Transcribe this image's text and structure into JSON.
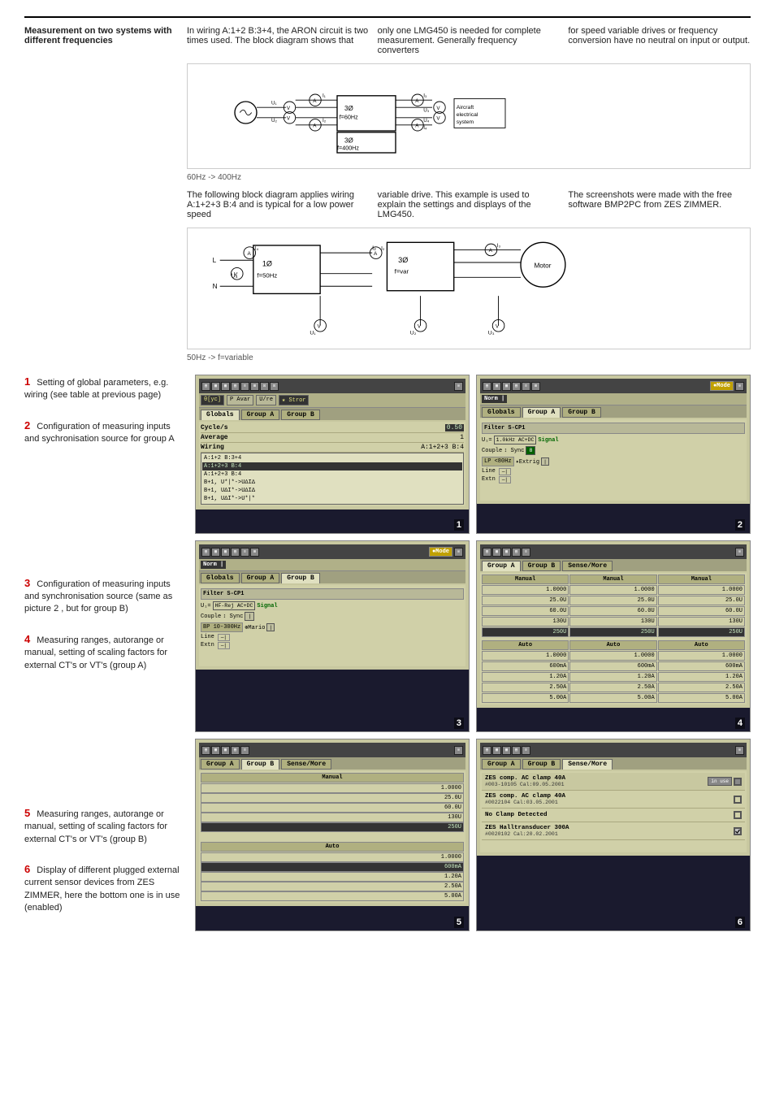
{
  "page": {
    "top": {
      "label": "Measurement on two systems with different frequencies",
      "col1": "In wiring A:1+2 B:3+4, the ARON circuit is two times used. The block diagram shows that",
      "col2": "only one LMG450 is needed for complete measurement. Generally frequency converters",
      "col3": "for speed variable drives or frequency conversion have no neutral on input or output."
    },
    "caption1": "60Hz -> 400Hz",
    "middle": {
      "col1": "The following block diagram applies wiring A:1+2+3 B:4 and is typical for a low power speed",
      "col2": "variable drive. This example is used to explain the settings and displays of the LMG450.",
      "col3": "The screenshots were made with the free software BMP2PC from ZES ZIMMER."
    },
    "caption2": "50Hz -> f=variable",
    "descriptions": [
      {
        "number": "1",
        "text": "Setting of global parameters, e.g. wiring (see table at previous page)"
      },
      {
        "number": "2",
        "text": "Configuration of measuring inputs and sychronisation source for group A"
      },
      {
        "number": "3",
        "text": "Configuration of measuring inputs and synchronisation source (same as picture 2 , but for group B)"
      },
      {
        "number": "4",
        "text": "Measuring ranges, autorange or manual, setting of scaling factors for external CT's or VT's (group A)"
      },
      {
        "number": "5",
        "text": "Measuring ranges, autorange or manual, setting of scaling factors for external CT's or VT's (group B)"
      },
      {
        "number": "6",
        "text": "Display of different plugged external current sensor devices from ZES ZIMMER, here the bottom one is in use (enabled)"
      }
    ],
    "screens": [
      {
        "id": 1,
        "tabs": [
          "Globals",
          "Group A",
          "Group B"
        ],
        "activeTab": "Globals",
        "rows": [
          {
            "label": "Cycle/s",
            "value": "0.50"
          },
          {
            "label": "Average",
            "value": "1"
          },
          {
            "label": "Wiring",
            "value": "A:1+2+3  B:4"
          }
        ],
        "wiringOptions": [
          "A:1+2  B:3+4",
          "A:1+2+3  B:4",
          "A:1+2+3  B:4",
          "B+1, U*|*->U∆I∆",
          "B+1, U∆I*->U∆I∆",
          "B+1, U∆|*->U*|*"
        ],
        "selectedWiring": 1,
        "indicators": [
          "θ[yc]",
          "P Avar",
          "U/re",
          "Stror"
        ]
      },
      {
        "id": 2,
        "tabs": [
          "Globals",
          "Group A",
          "Group B"
        ],
        "activeTab": "Group A",
        "rightTab": "Mode Norm",
        "filter": "Filter S-CP1",
        "filterValue": "1.0kHz AC+DC",
        "coupler": "Couple LP <80Hz",
        "sync": "Sync",
        "syncBtn": "8",
        "extrig": "Extrig",
        "line": "Line",
        "extn": "Extn",
        "label": "Signal"
      },
      {
        "id": 3,
        "tabs": [
          "Globals",
          "Group A",
          "Group B"
        ],
        "activeTab": "Group B",
        "rightTab": "Mode Norm",
        "filter": "Filter S-CP1",
        "filterValue": "HF-Rej AC+DC",
        "coupler": "Couple BP 10-300Hz",
        "sync": "Sync",
        "extrig": "Mario",
        "line": "Line",
        "extn": "Extn",
        "label": "Signal"
      },
      {
        "id": 4,
        "tabs": [
          "Group A",
          "Group B",
          "Sense/More"
        ],
        "activeTab": "Group A",
        "voltageHeaders": [
          "Manual",
          "Manual",
          "Manual"
        ],
        "voltages": [
          "1.0000",
          "1.0000",
          "1.0000",
          "25.0U",
          "25.0U",
          "25.0U",
          "60.0U",
          "60.0U",
          "60.0U",
          "130U",
          "130U",
          "130U",
          "250U",
          "250U",
          "250U"
        ],
        "autoHeaders": [
          "Auto",
          "Auto",
          "Auto"
        ],
        "currents": [
          "1.0000",
          "1.0000",
          "1.0000",
          "600mA",
          "600mA",
          "600mA",
          "1.20A",
          "1.20A",
          "1.20A",
          "2.50A",
          "2.50A",
          "2.50A",
          "5.00A",
          "5.00A",
          "5.00A"
        ]
      },
      {
        "id": 5,
        "tabs": [
          "Group A",
          "Group B",
          "Sense/More"
        ],
        "activeTab": "Group B",
        "voltageHeaders": [
          "Manual"
        ],
        "voltages5": [
          "1.0000",
          "25.0U",
          "60.0U",
          "130U",
          "250U"
        ],
        "autoHeader": "Auto",
        "currents5": [
          "1.0000",
          "600mA",
          "1.20A",
          "2.50A",
          "5.00A"
        ],
        "selectedVoltage": "250U",
        "selectedCurrent": "600mA"
      },
      {
        "id": 6,
        "items": [
          {
            "name": "ZES comp. AC clamp 40A",
            "cal": "#003-10105  Cal:09.05.2001",
            "inUse": true,
            "checked": false,
            "hasIcon": true
          },
          {
            "name": "ZES comp. AC clamp 40A",
            "cal": "#0022104  Cal:03.05.2001",
            "inUse": false,
            "checked": false,
            "hasIcon": false
          },
          {
            "name": "No Clamp Detected",
            "cal": "",
            "inUse": false,
            "checked": false,
            "hasIcon": false
          },
          {
            "name": "ZES Halltransducer 300A",
            "cal": "#0020102  Cal:20.02.2001",
            "inUse": false,
            "checked": true,
            "hasIcon": false
          }
        ]
      }
    ]
  }
}
